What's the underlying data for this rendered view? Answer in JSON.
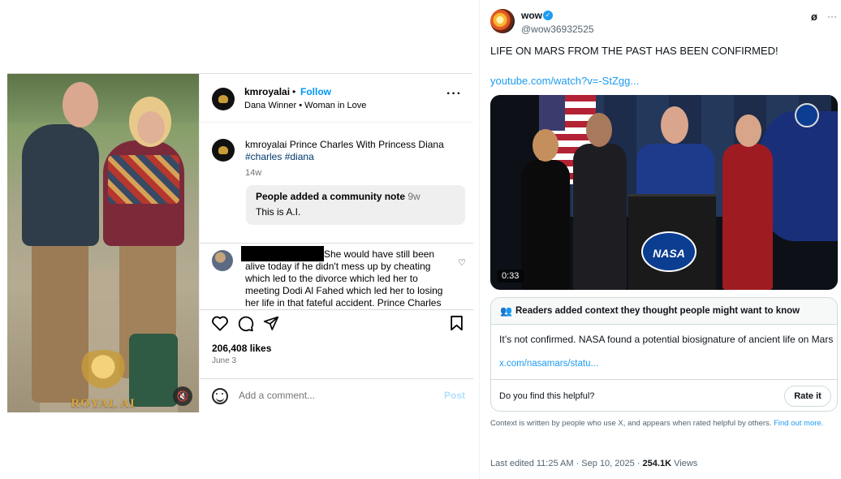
{
  "instagram": {
    "media": {
      "watermark": "ROYAL AI"
    },
    "header": {
      "username": "kmroyalai",
      "separator": "•",
      "follow_label": "Follow",
      "music": "Dana Winner • Woman in Love",
      "more_label": "···"
    },
    "caption": {
      "username": "kmroyalai",
      "text": "Prince Charles With Princess Diana",
      "tag1": "#charles",
      "tag2": "#diana",
      "age": "14w"
    },
    "community_note": {
      "title": "People added a community note",
      "age": "9w",
      "body": "This is A.I."
    },
    "comment": {
      "text": "She would have still been alive today if he didn't mess up by cheating which led to the divorce which led her to meeting Dodi Al Fahed which led her to losing her life in that fateful accident. Prince Charles"
    },
    "likes": "206,408 likes",
    "date": "June 3",
    "add_comment_placeholder": "Add a comment...",
    "post_label": "Post"
  },
  "x": {
    "name": "wow",
    "handle": "@wow36932525",
    "grok_glyph": "ø",
    "more_label": "···",
    "text": "LIFE ON MARS FROM THE PAST HAS BEEN CONFIRMED!",
    "link": "youtube.com/watch?v=-StZgg...",
    "video": {
      "duration": "0:33",
      "logo": "NASA"
    },
    "context": {
      "title": "Readers added context they thought people might want to know",
      "body": "It’s not confirmed. NASA found a potential biosignature of ancient life on Mars",
      "link": "x.com/nasamars/statu...",
      "question": "Do you find this helpful?",
      "rate_label": "Rate it"
    },
    "disclaimer": "Context is written by people who use X, and appears when rated helpful by others.",
    "disclaimer_link": "Find out more.",
    "meta": {
      "edited": "Last edited 11:25 AM · Sep 10, 2025 · ",
      "views_count": "254.1K",
      "views_label": " Views"
    }
  },
  "colors": {
    "ig_link": "#0095f6",
    "x_link": "#1d9bf0",
    "note_bg": "#efefef"
  }
}
